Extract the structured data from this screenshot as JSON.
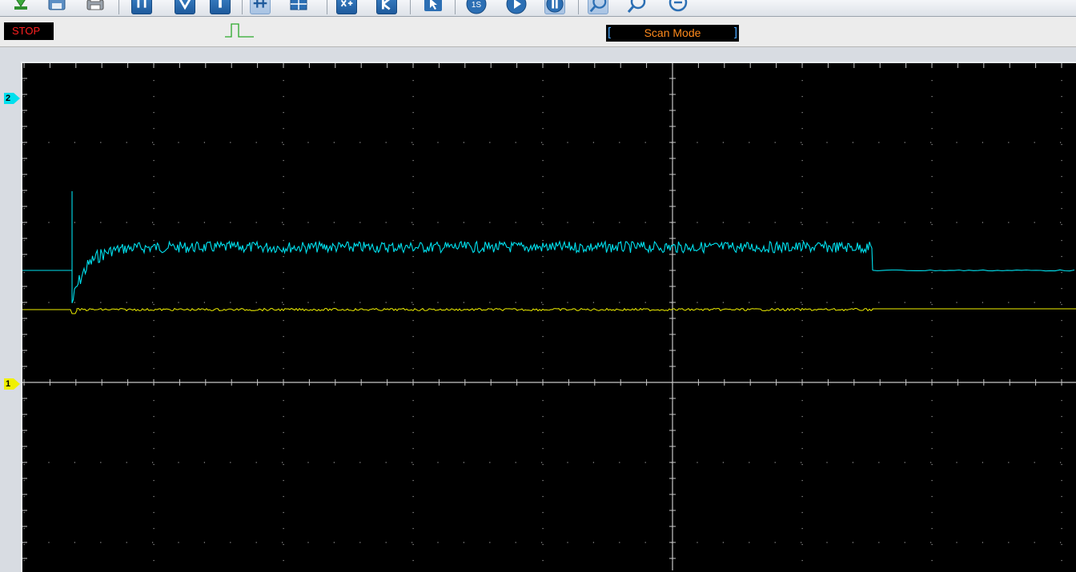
{
  "status": {
    "run_state": "STOP"
  },
  "acquisition": {
    "mode_label": "Scan Mode"
  },
  "channels": [
    {
      "id": "2",
      "color": "#00e0ee",
      "marker_label": "2"
    },
    {
      "id": "1",
      "color": "#f0f000",
      "marker_label": "1"
    }
  ],
  "colors": {
    "background": "#000000",
    "grid": "#c8c8c8",
    "stop_text": "#ff2020",
    "scan_text": "#ff8a1c",
    "toolbar_accent": "#2c6fb4"
  },
  "toolbar": {
    "icons": [
      "download-icon",
      "save-icon",
      "print-icon",
      "horizontal-cursor-icon",
      "vertical-cursor-icon",
      "trigger-cursor-icon",
      "split-view-icon",
      "dual-view-icon",
      "xy-mode-icon",
      "measure-icon",
      "pointer-icon",
      "single-run-icon",
      "play-icon",
      "pause-icon",
      "zoom-in-icon",
      "zoom-out-icon",
      "zoom-reset-icon"
    ]
  }
}
